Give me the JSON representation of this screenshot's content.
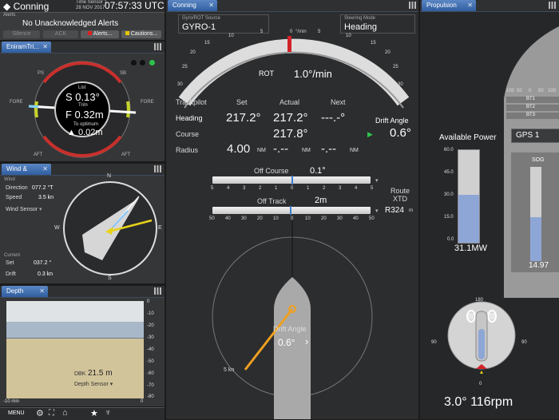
{
  "header": {
    "title": "Conning",
    "time_label": "Time Sensor 1",
    "date": "28 NOV 2017",
    "clock": "07:57:33 UTC"
  },
  "alerts": {
    "label": "Alerts",
    "message": "No Unacknowledged Alerts",
    "silence": "Silence",
    "ack": "ACK",
    "alerts_button": "Alerts...",
    "cautions_button": "Cautions..."
  },
  "enirami": {
    "tab": "EniramTri...",
    "list_label": "List",
    "list_value": "S 0.13°",
    "trim_label": "Trim",
    "trim_value": "F 0.32m",
    "optimum_label": "To optimum",
    "optimum_value": "▲ 0.02m",
    "fore": "FORE",
    "aft": "AFT",
    "ps": "PS",
    "sb": "SB"
  },
  "wind": {
    "tab": "Wind & C...",
    "section_label": "Wind",
    "direction_label": "Direction",
    "direction_value": "077.2 °T",
    "speed_label": "Speed",
    "speed_value": "3.5 kn",
    "sensor": "Wind Sensor",
    "current_label": "Current",
    "set_label": "Set",
    "set_value": "037.2 °",
    "drift_label": "Drift",
    "drift_value": "0.3 kn",
    "compass": {
      "n": "N",
      "e": "E",
      "s": "S",
      "w": "W"
    }
  },
  "depth": {
    "tab": "Depth",
    "dbk_label": "DBK",
    "dbk_value": "21.5 m",
    "sensor": "Depth Sensor",
    "ticks": [
      "0",
      "-10",
      "-20",
      "-30",
      "-40",
      "-50",
      "-60",
      "-70",
      "-80"
    ],
    "bottom_left": "-10 min",
    "bottom_right": "0"
  },
  "bottom_menu": {
    "menu": "MENU"
  },
  "conning": {
    "tab": "Conning H...",
    "gyro_label": "Gyro/ROT Source",
    "gyro_value": "GYRO-1",
    "steering_label": "Steering Mode",
    "steering_value": "Heading",
    "rot_label": "ROT",
    "rot_value": "1.0°/min",
    "rot_unit": "°/min",
    "rot_ticks": [
      "30",
      "25",
      "20",
      "15",
      "10",
      "5",
      "0",
      "5",
      "10",
      "15",
      "20",
      "25",
      "30"
    ],
    "trackpilot_label": "Trackpilot",
    "set_header": "Set",
    "actual_header": "Actual",
    "next_header": "Next",
    "heading_label": "Heading",
    "heading_set": "217.2°",
    "heading_actual": "217.2°",
    "heading_next": "---.-°",
    "course_label": "Course",
    "course_actual": "217.8°",
    "radius_label": "Radius",
    "radius_set": "4.00",
    "radius_unit": "NM",
    "radius_actual": "-.--",
    "radius_next": "-.--",
    "drift_angle_label": "Drift Angle",
    "drift_angle_value": "0.6°",
    "off_course_label": "Off Course",
    "off_course_value": "0.1°",
    "off_course_ticks": [
      "5",
      "4",
      "3",
      "2",
      "1",
      "0",
      "1",
      "2",
      "3",
      "4",
      "5"
    ],
    "off_track_label": "Off Track",
    "off_track_value": "2m",
    "off_track_ticks": [
      "50",
      "40",
      "30",
      "20",
      "10",
      "0",
      "10",
      "20",
      "30",
      "40",
      "50"
    ],
    "route_label": "Route",
    "xtd_label": "XTD",
    "xtd_value": "R324",
    "xtd_unit": "m",
    "ship_drift_label": "Drift Angle",
    "ship_drift_value": "0.6°",
    "speed_vector_label": "5 kn"
  },
  "propulsion": {
    "tab": "Propulsion",
    "thruster_ticks": [
      "100",
      "50",
      "0",
      "50",
      "100"
    ],
    "thrusters": [
      "BT1",
      "BT2",
      "BT3"
    ],
    "available_power_label": "Available Power",
    "power_ticks": [
      "60.0",
      "45.0",
      "30.0",
      "15.0",
      "0.0"
    ],
    "power_value": "31.1MW",
    "power_fraction": 0.52,
    "gps_value": "GPS 1",
    "sog_label": "SOG",
    "sog_value": "14.97",
    "pod_ticks": {
      "top": "180",
      "left": "90",
      "right": "90",
      "bottom": "0"
    },
    "pod_value": "3.0° 116rpm"
  }
}
